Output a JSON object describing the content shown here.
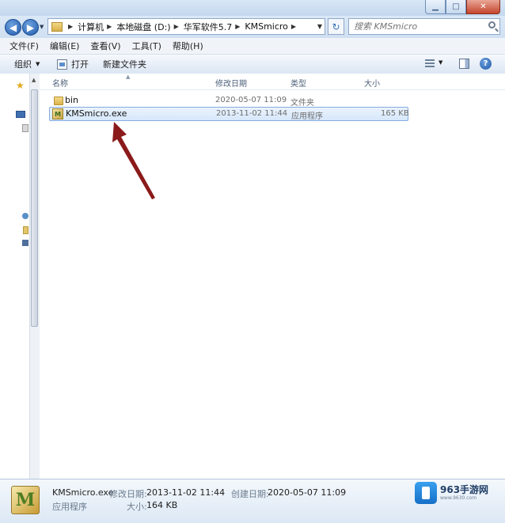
{
  "address": {
    "crumbs": [
      "计算机",
      "本地磁盘 (D:)",
      "华军软件5.7",
      "KMSmicro"
    ],
    "search_placeholder": "搜索 KMSmicro"
  },
  "menu": [
    "文件(F)",
    "编辑(E)",
    "查看(V)",
    "工具(T)",
    "帮助(H)"
  ],
  "toolbar": {
    "organize": "组织",
    "open": "打开",
    "new_folder": "新建文件夹"
  },
  "columns": {
    "name": "名称",
    "modified": "修改日期",
    "type": "类型",
    "size": "大小"
  },
  "files": [
    {
      "name": "bin",
      "modified": "2020-05-07 11:09",
      "type": "文件夹",
      "size": "",
      "kind": "folder",
      "selected": false
    },
    {
      "name": "KMSmicro.exe",
      "modified": "2013-11-02 11:44",
      "type": "应用程序",
      "size": "165 KB",
      "kind": "exe",
      "selected": true
    }
  ],
  "details": {
    "file_name": "KMSmicro.exe",
    "modified_label": "修改日期:",
    "modified_value": "2013-11-02 11:44",
    "created_label": "创建日期:",
    "created_value": "2020-05-07 11:09",
    "type_value": "应用程序",
    "size_label": "大小:",
    "size_value": "164 KB"
  },
  "watermark": {
    "brand": "963手游网",
    "url": "www.9630.com"
  },
  "colors": {
    "selection_border": "#84acdd",
    "annotation_arrow": "#8b1a1a"
  }
}
